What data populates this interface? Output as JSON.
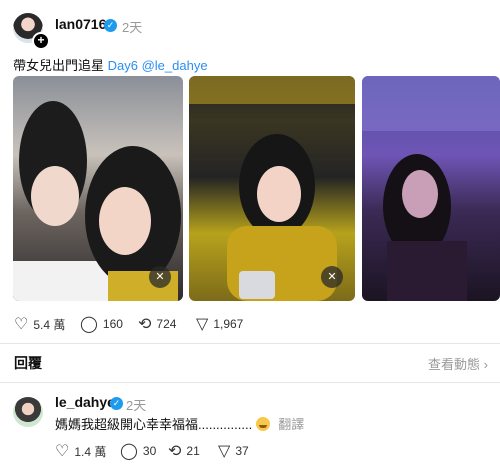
{
  "post": {
    "username": "lan0716",
    "time": "2天",
    "text_prefix": "帶女兒出門追星",
    "link_text": "Day6 @le_dahye",
    "likes": "5.4 萬",
    "comments": "160",
    "reposts": "724",
    "shares": "1,967"
  },
  "replies_section": {
    "label": "回覆",
    "view_activity": "查看動態 ›"
  },
  "reply": {
    "username": "le_dahye",
    "time": "2天",
    "text": "媽媽我超級開心幸幸福福...............",
    "translate": "翻譯",
    "likes": "1.4 萬",
    "comments": "30",
    "reposts": "21",
    "shares": "37"
  },
  "icons": {
    "verified": "verified-badge-icon",
    "like": "heart-icon",
    "comment": "comment-bubble-icon",
    "repost": "repost-icon",
    "share": "send-icon",
    "mute": "muted-speaker-icon"
  },
  "colors": {
    "link": "#2a8ef2",
    "verified": "#1d9bf0"
  }
}
